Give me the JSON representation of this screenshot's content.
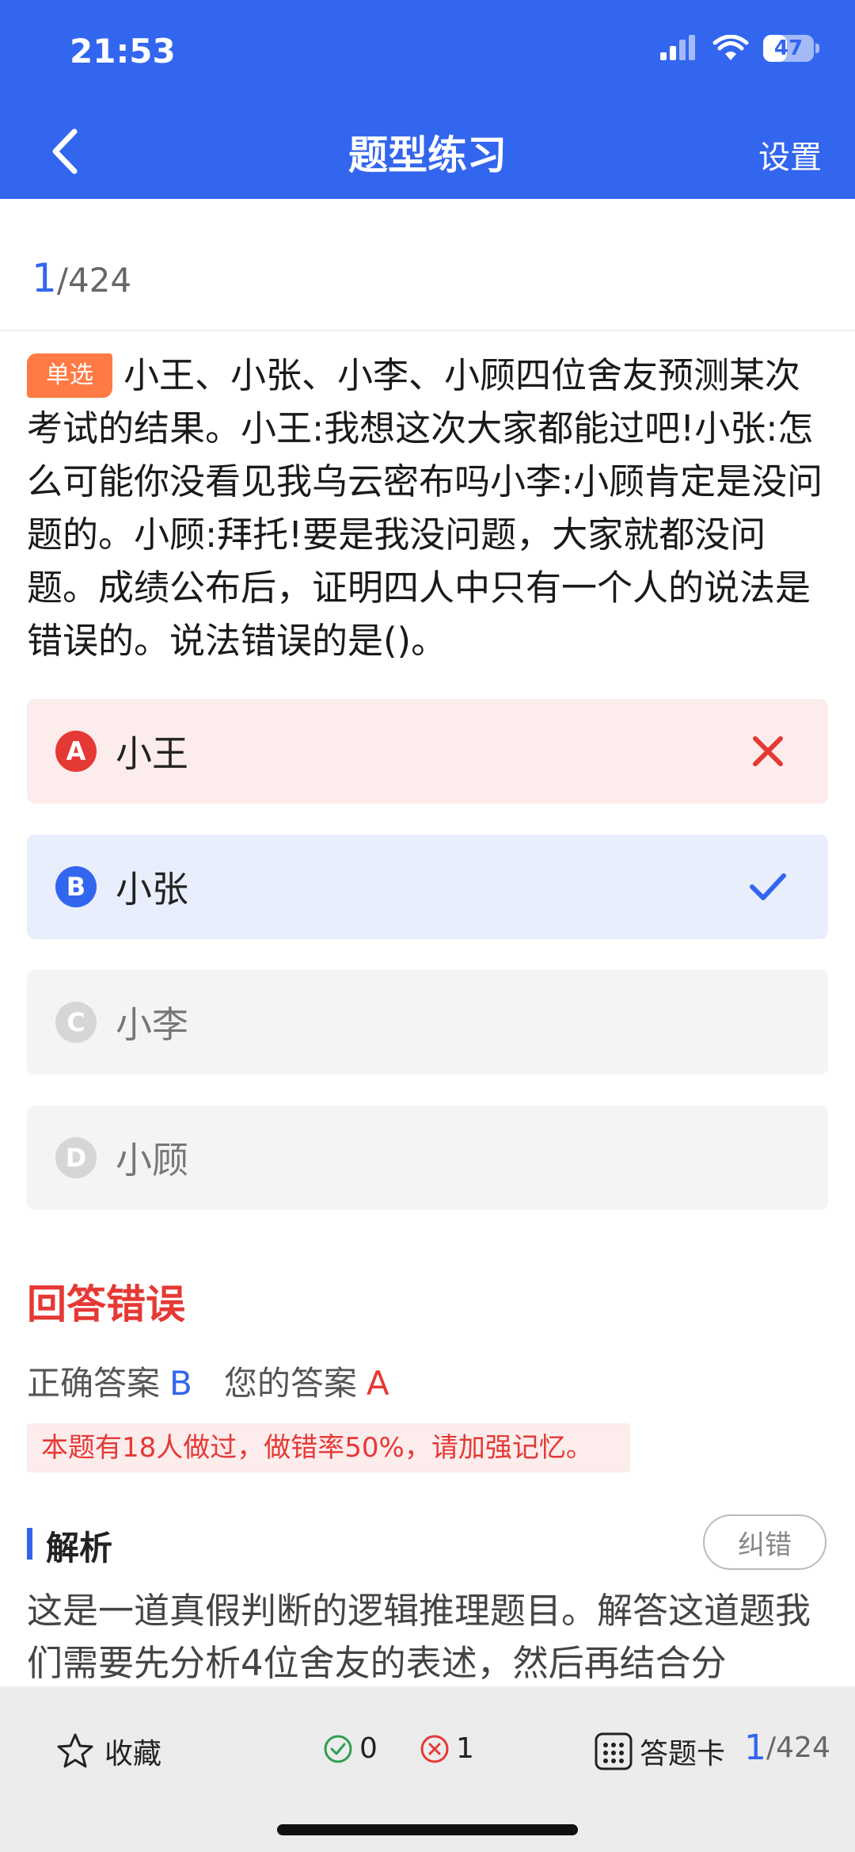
{
  "status_bar": {
    "time": "21:53",
    "battery_level": "47"
  },
  "nav": {
    "title": "题型练习",
    "settings_label": "设置"
  },
  "progress": {
    "current": "1",
    "total": "/424"
  },
  "question": {
    "type_badge": "单选",
    "text": "小王、小张、小李、小顾四位舍友预测某次考试的结果。小王:我想这次大家都能过吧!小张:怎么可能你没看见我乌云密布吗小李:小顾肯定是没问题的。小顾:拜托!要是我没问题，大家就都没问题。成绩公布后，证明四人中只有一个人的说法是错误的。说法错误的是()。"
  },
  "options": [
    {
      "letter": "A",
      "text": "小王",
      "state": "wrong"
    },
    {
      "letter": "B",
      "text": "小张",
      "state": "correct"
    },
    {
      "letter": "C",
      "text": "小李",
      "state": "neutral"
    },
    {
      "letter": "D",
      "text": "小顾",
      "state": "neutral"
    }
  ],
  "result": {
    "title": "回答错误",
    "correct_label": "正确答案",
    "correct_value": "B",
    "your_label": "您的答案",
    "your_value": "A",
    "tip": "本题有18人做过，做错率50%，请加强记忆。"
  },
  "analysis": {
    "title": "解析",
    "report_label": "纠错",
    "text": "这是一道真假判断的逻辑推理题目。解答这道题我们需要先分析4位舍友的表述，然后再结合分"
  },
  "bottom": {
    "favorite_label": "收藏",
    "correct_count": "0",
    "wrong_count": "1",
    "card_label": "答题卡",
    "progress_current": "1",
    "progress_total": "/424"
  },
  "colors": {
    "primary": "#3366ee",
    "error": "#e53935",
    "success": "#2e9e4f",
    "badge": "#ff7a45"
  }
}
